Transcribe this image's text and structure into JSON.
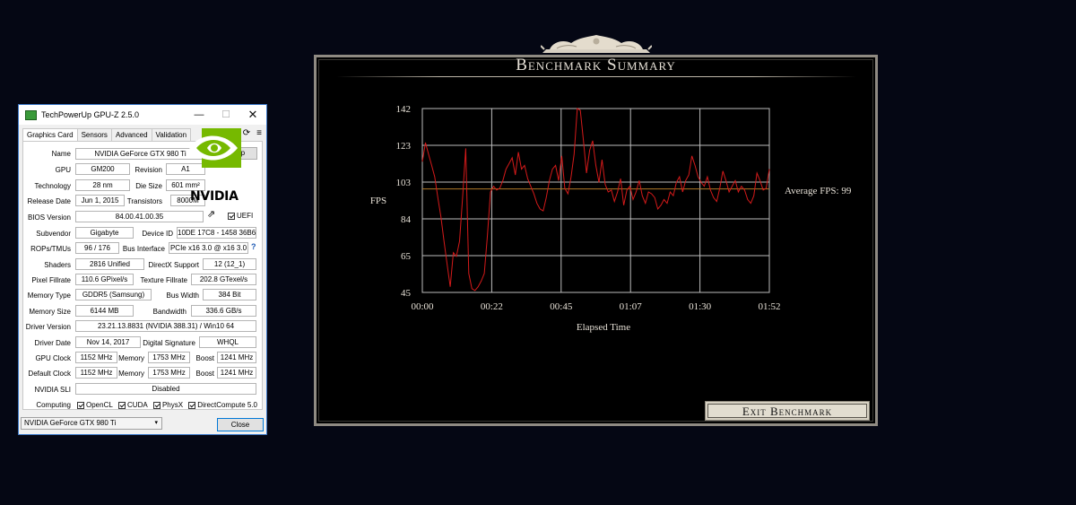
{
  "gpuz": {
    "title": "TechPowerUp GPU-Z 2.5.0",
    "window_buttons": {
      "minimize": "—",
      "maximize": "☐",
      "close": "✕"
    },
    "tabs": [
      "Graphics Card",
      "Sensors",
      "Advanced",
      "Validation"
    ],
    "lookup_label": "Lookup",
    "uefi_label": "UEFI",
    "vendor_logo_text": "NVIDIA",
    "fields": {
      "name": {
        "label": "Name",
        "value": "NVIDIA GeForce GTX 980 Ti"
      },
      "gpu": {
        "label": "GPU",
        "value": "GM200"
      },
      "revision": {
        "label": "Revision",
        "value": "A1"
      },
      "technology": {
        "label": "Technology",
        "value": "28 nm"
      },
      "die_size": {
        "label": "Die Size",
        "value": "601 mm²"
      },
      "release_date": {
        "label": "Release Date",
        "value": "Jun 1, 2015"
      },
      "transistors": {
        "label": "Transistors",
        "value": "8000M"
      },
      "bios_version": {
        "label": "BIOS Version",
        "value": "84.00.41.00.35"
      },
      "subvendor": {
        "label": "Subvendor",
        "value": "Gigabyte"
      },
      "device_id": {
        "label": "Device ID",
        "value": "10DE 17C8 - 1458 36B6"
      },
      "rops_tmus": {
        "label": "ROPs/TMUs",
        "value": "96 / 176"
      },
      "bus_interface": {
        "label": "Bus Interface",
        "value": "PCIe x16 3.0 @ x16 3.0"
      },
      "shaders": {
        "label": "Shaders",
        "value": "2816 Unified"
      },
      "directx": {
        "label": "DirectX Support",
        "value": "12 (12_1)"
      },
      "pixel_fillrate": {
        "label": "Pixel Fillrate",
        "value": "110.6 GPixel/s"
      },
      "texture_fillrate": {
        "label": "Texture Fillrate",
        "value": "202.8 GTexel/s"
      },
      "memory_type": {
        "label": "Memory Type",
        "value": "GDDR5 (Samsung)"
      },
      "bus_width": {
        "label": "Bus Width",
        "value": "384 Bit"
      },
      "memory_size": {
        "label": "Memory Size",
        "value": "6144 MB"
      },
      "bandwidth": {
        "label": "Bandwidth",
        "value": "336.6 GB/s"
      },
      "driver_version": {
        "label": "Driver Version",
        "value": "23.21.13.8831 (NVIDIA 388.31) / Win10 64"
      },
      "driver_date": {
        "label": "Driver Date",
        "value": "Nov 14, 2017"
      },
      "digital_signature": {
        "label": "Digital Signature",
        "value": "WHQL"
      },
      "gpu_clock": {
        "label": "GPU Clock",
        "value": "1152 MHz"
      },
      "gpu_memory": {
        "label": "Memory",
        "value": "1753 MHz"
      },
      "gpu_boost": {
        "label": "Boost",
        "value": "1241 MHz"
      },
      "default_clock": {
        "label": "Default Clock",
        "value": "1152 MHz"
      },
      "default_memory": {
        "label": "Memory",
        "value": "1753 MHz"
      },
      "default_boost": {
        "label": "Boost",
        "value": "1241 MHz"
      },
      "nvidia_sli": {
        "label": "NVIDIA SLI",
        "value": "Disabled"
      },
      "computing": {
        "label": "Computing"
      }
    },
    "computing_items": [
      "OpenCL",
      "CUDA",
      "PhysX",
      "DirectCompute 5.0"
    ],
    "help_icon_text": "?",
    "selected_card": "NVIDIA GeForce GTX 980 Ti",
    "close_label": "Close"
  },
  "benchmark": {
    "title": "Benchmark Summary",
    "average_label": "Average FPS: 99.6",
    "exit_label": "Exit Benchmark"
  },
  "chart_data": {
    "type": "line",
    "title": "",
    "xlabel": "Elapsed Time",
    "ylabel": "FPS",
    "x_ticks": [
      "00:00",
      "00:22",
      "00:45",
      "01:07",
      "01:30",
      "01:52"
    ],
    "y_ticks": [
      "45",
      "65",
      "84",
      "103",
      "123",
      "142"
    ],
    "ylim": [
      45,
      142
    ],
    "xlim_seconds": [
      0,
      112
    ],
    "grid": true,
    "average_fps": 99.6,
    "series": [
      {
        "name": "",
        "color": "#d41a1a",
        "x": [
          0,
          1,
          2,
          3,
          4,
          5,
          6,
          7,
          8,
          9,
          10,
          11,
          12,
          13,
          14,
          15,
          16,
          17,
          18,
          19,
          20,
          21,
          22,
          23,
          24,
          25,
          26,
          27,
          28,
          29,
          30,
          31,
          32,
          33,
          34,
          35,
          36,
          37,
          38,
          39,
          40,
          41,
          42,
          43,
          44,
          45,
          46,
          47,
          48,
          49,
          50,
          51,
          52,
          53,
          54,
          55,
          56,
          57,
          58,
          59,
          60,
          61,
          62,
          63,
          64,
          65,
          66,
          67,
          68,
          69,
          70,
          71,
          72,
          73,
          74,
          75,
          76,
          77,
          78,
          79,
          80,
          81,
          82,
          83,
          84,
          85,
          86,
          87,
          88,
          89,
          90,
          91,
          92,
          93,
          94,
          95,
          96,
          97,
          98,
          99,
          100,
          101,
          102,
          103,
          104,
          105,
          106,
          107,
          108,
          109,
          110,
          111,
          112
        ],
        "values": [
          114,
          124,
          118,
          112,
          106,
          95,
          85,
          72,
          60,
          48,
          66,
          64,
          72,
          95,
          121,
          55,
          47,
          46,
          48,
          51,
          55,
          75,
          98,
          101,
          99,
          100,
          104,
          110,
          113,
          116,
          107,
          119,
          110,
          112,
          105,
          101,
          97,
          92,
          89,
          88,
          95,
          104,
          110,
          112,
          104,
          117,
          100,
          97,
          106,
          118,
          142,
          141,
          125,
          108,
          120,
          125,
          112,
          103,
          115,
          102,
          98,
          99,
          93,
          98,
          105,
          91,
          99,
          101,
          94,
          98,
          104,
          96,
          92,
          98,
          97,
          95,
          89,
          91,
          94,
          92,
          98,
          96,
          103,
          106,
          98,
          104,
          107,
          117,
          112,
          106,
          103,
          101,
          106,
          99,
          95,
          93,
          100,
          109,
          104,
          98,
          101,
          104,
          98,
          101,
          99,
          94,
          92,
          96,
          108,
          104,
          99,
          100,
          110
        ]
      }
    ]
  }
}
